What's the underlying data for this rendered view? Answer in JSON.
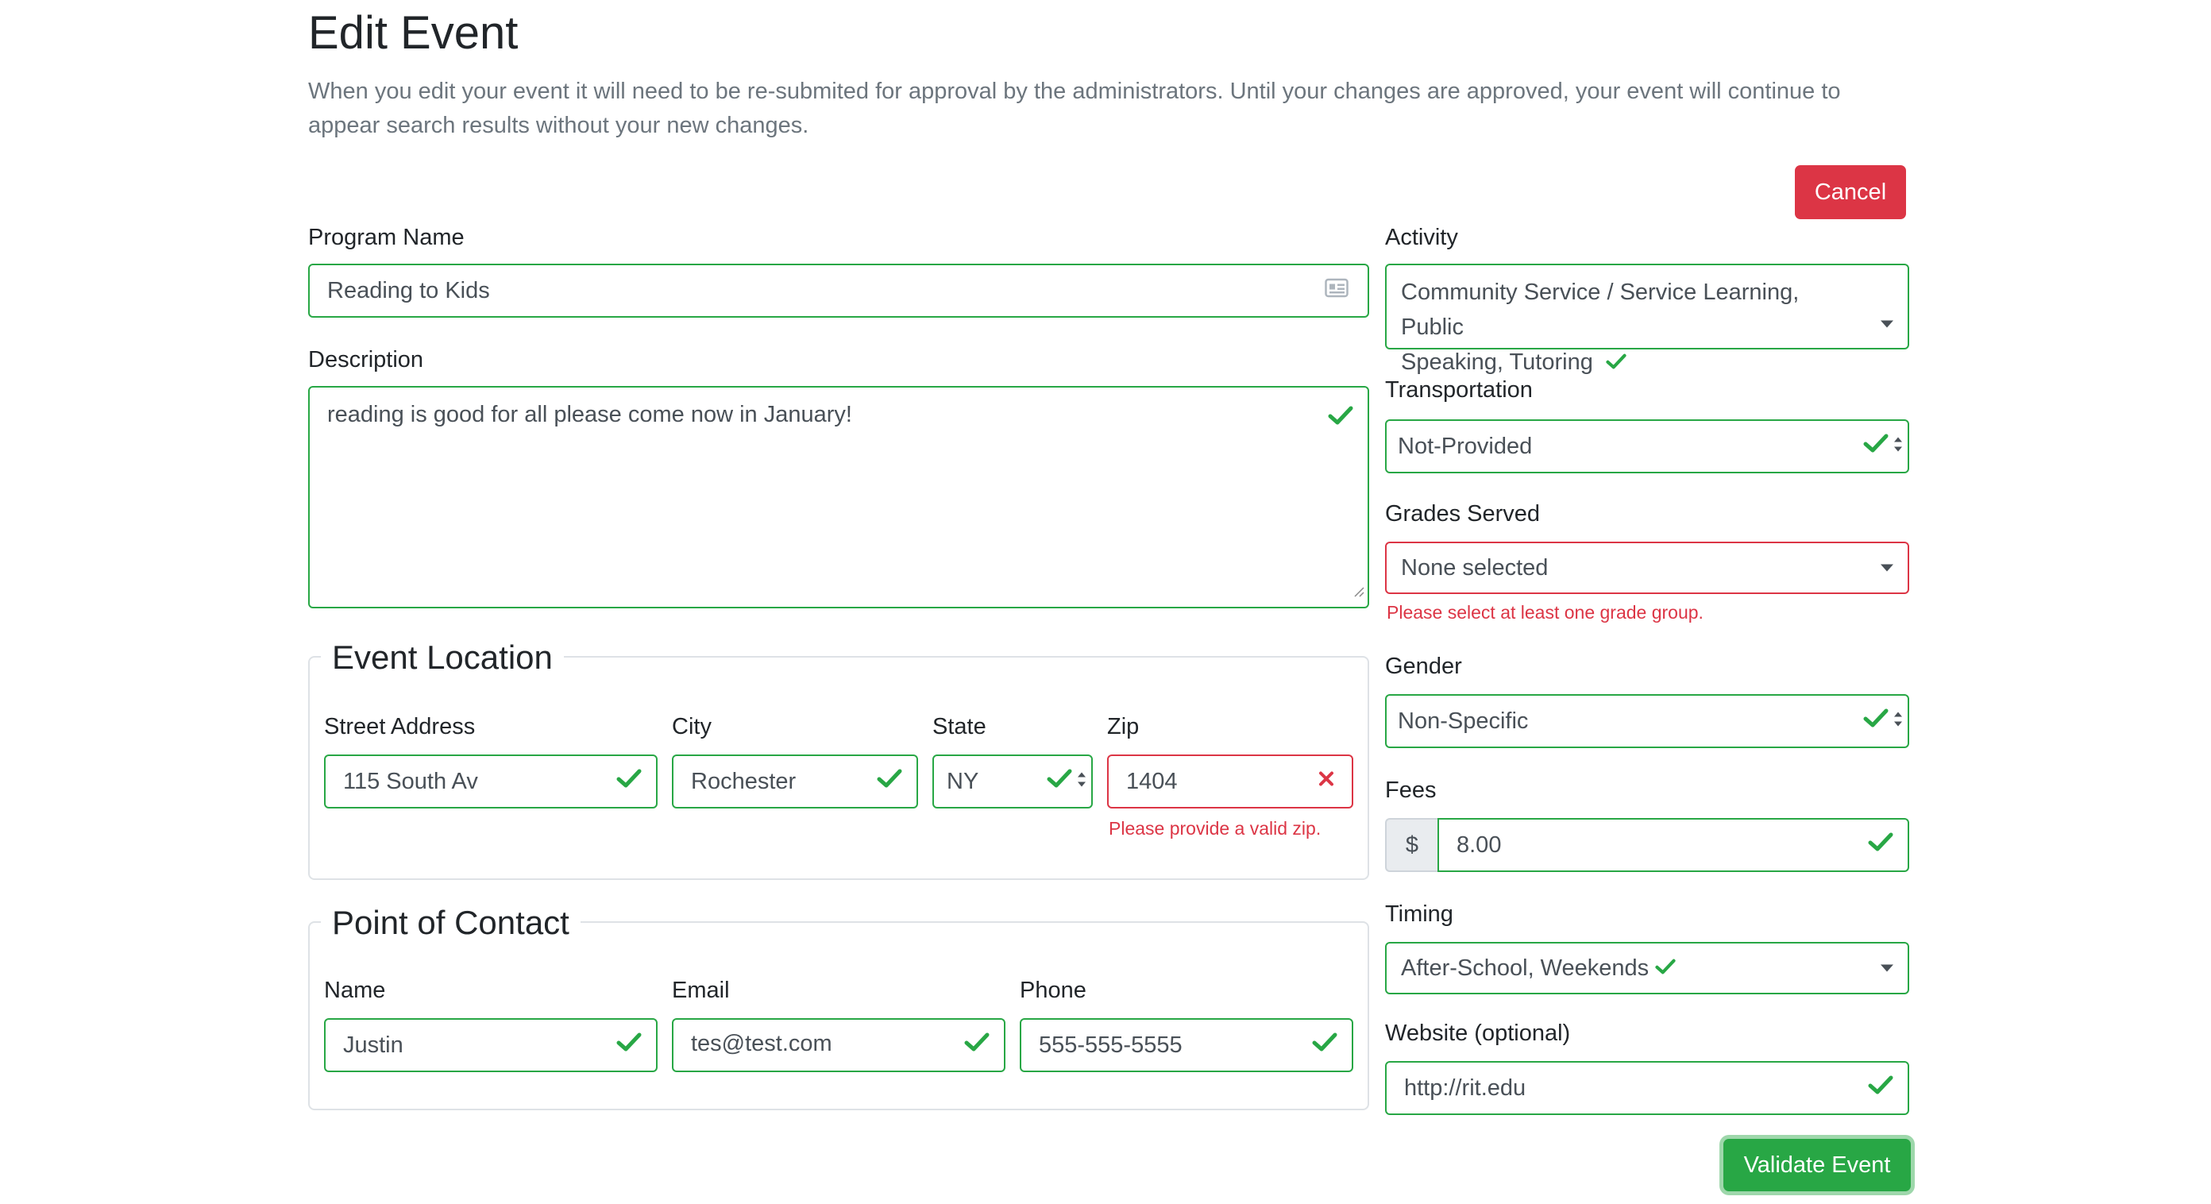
{
  "header": {
    "title": "Edit Event",
    "description": "When you edit your event it will need to be re-submited for approval by the administrators. Until your changes are approved, your event will continue to appear search results without your new changes."
  },
  "buttons": {
    "cancel": "Cancel",
    "validate": "Validate Event"
  },
  "program_name": {
    "label": "Program Name",
    "value": "Reading to Kids"
  },
  "description": {
    "label": "Description",
    "value": "reading is good for all please come now in January!"
  },
  "location": {
    "legend": "Event Location",
    "street": {
      "label": "Street Address",
      "value": "115 South Av"
    },
    "city": {
      "label": "City",
      "value": "Rochester"
    },
    "state": {
      "label": "State",
      "value": "NY"
    },
    "zip": {
      "label": "Zip",
      "value": "1404",
      "error": "Please provide a valid zip."
    }
  },
  "contact": {
    "legend": "Point of Contact",
    "name": {
      "label": "Name",
      "value": "Justin"
    },
    "email": {
      "label": "Email",
      "value": "tes@test.com"
    },
    "phone": {
      "label": "Phone",
      "value": "555-555-5555"
    }
  },
  "activity": {
    "label": "Activity",
    "line1": "Community Service / Service Learning, Public",
    "line2": "Speaking, Tutoring"
  },
  "transportation": {
    "label": "Transportation",
    "value": "Not-Provided"
  },
  "grades": {
    "label": "Grades Served",
    "value": "None selected",
    "error": "Please select at least one grade group."
  },
  "gender": {
    "label": "Gender",
    "value": "Non-Specific"
  },
  "fees": {
    "label": "Fees",
    "prefix": "$",
    "value": "8.00"
  },
  "timing": {
    "label": "Timing",
    "value": "After-School, Weekends"
  },
  "website": {
    "label": "Website (optional)",
    "value": "http://rit.edu"
  },
  "colors": {
    "valid": "#28a745",
    "invalid": "#dc3545",
    "cancel_bg": "#dc3545",
    "validate_bg": "#28a745"
  }
}
